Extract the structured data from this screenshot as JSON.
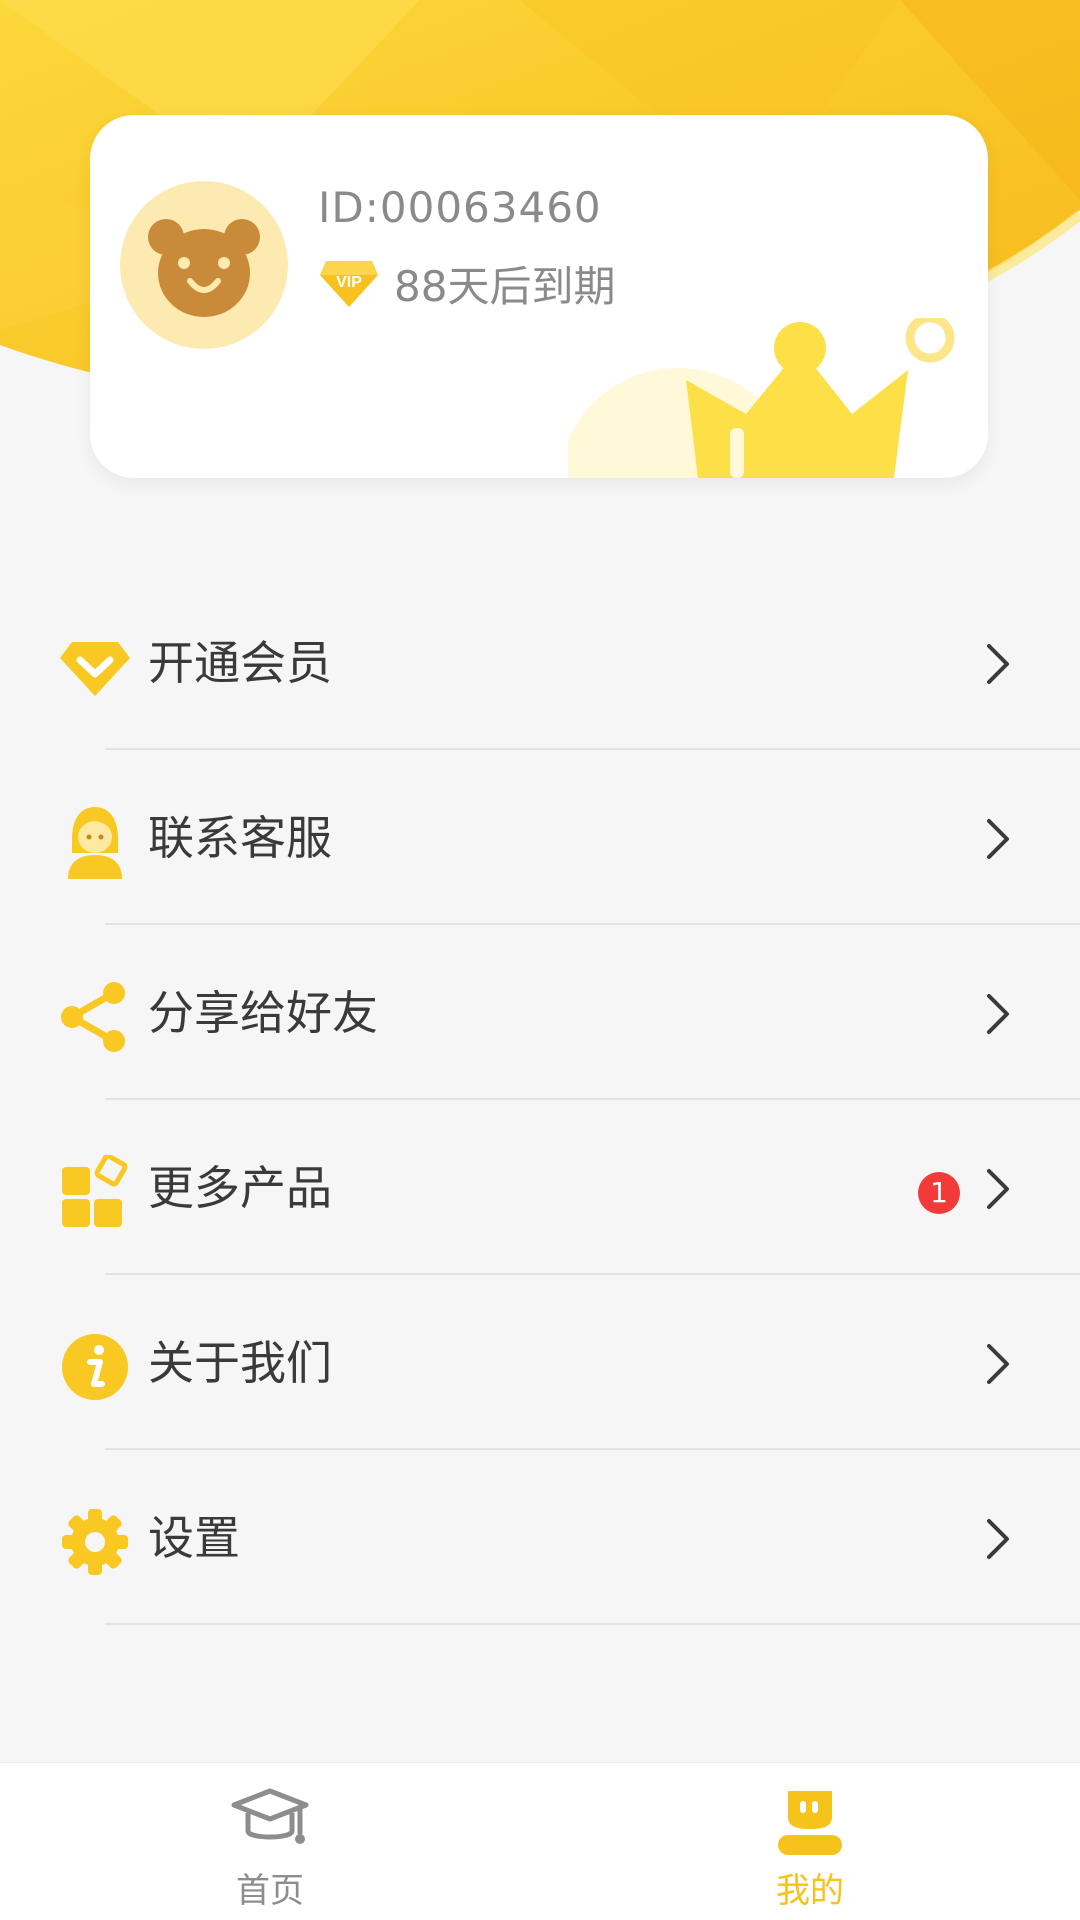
{
  "colors": {
    "accent": "#f6c21c",
    "accent_light": "#fde27a",
    "text_primary": "#3a3a3a",
    "text_secondary": "#8a8a8a",
    "badge_red": "#f23a3a",
    "background": "#f6f6f6"
  },
  "profile": {
    "id_text": "ID:00063460",
    "vip_badge_text": "VIP",
    "vip_expire_text": "88天后到期",
    "avatar_icon": "bear-face-icon"
  },
  "menu": {
    "items": [
      {
        "label": "开通会员",
        "icon": "diamond-icon"
      },
      {
        "label": "联系客服",
        "icon": "customer-service-icon"
      },
      {
        "label": "分享给好友",
        "icon": "share-icon"
      },
      {
        "label": "更多产品",
        "icon": "apps-icon",
        "badge": "1"
      },
      {
        "label": "关于我们",
        "icon": "info-icon"
      },
      {
        "label": "设置",
        "icon": "gear-icon"
      }
    ]
  },
  "bottom_nav": {
    "tabs": [
      {
        "label": "首页",
        "icon": "graduation-cap-icon",
        "active": false
      },
      {
        "label": "我的",
        "icon": "robot-icon",
        "active": true
      }
    ]
  }
}
